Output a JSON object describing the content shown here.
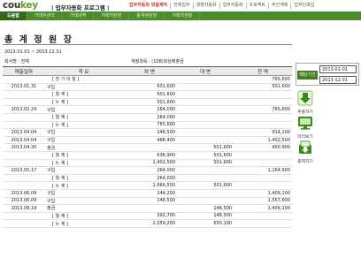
{
  "app": {
    "logo_main": "cou",
    "logo_accent": "key",
    "title": "| 업무자동화 프로그램 |"
  },
  "top_nav": [
    {
      "label": "업무자동화 맞춤제작",
      "active": true
    },
    {
      "label": "전체업무"
    },
    {
      "label": "경영자동화"
    },
    {
      "label": "업무자동화"
    },
    {
      "label": "프로젝트"
    },
    {
      "label": "주간계획"
    },
    {
      "label": "업무단축입"
    }
  ],
  "tabs": [
    {
      "label": "도움말",
      "active": true
    },
    {
      "label": "거래처관리"
    },
    {
      "label": "거래내역"
    },
    {
      "label": "거래처원장"
    },
    {
      "label": "총계정원장"
    },
    {
      "label": "거래처현황"
    }
  ],
  "page": {
    "title": "총 계 정 원 장",
    "date_range": "2013.01.01 ~ 2013.12.31",
    "company_label": "회사명 : 전체",
    "account_label": "계정과목 : (108)외상매출금"
  },
  "table": {
    "headers": [
      "매출일자",
      "적          요",
      "차          변",
      "대          변",
      "잔          액"
    ],
    "rows": [
      [
        "",
        "[ 전  기  이  월 ]",
        "",
        "",
        "765,600"
      ],
      [
        "2013.01.31",
        "구입",
        "501,600",
        "",
        "501,600"
      ],
      [
        "",
        "[    월        계    ]",
        "501,600",
        "",
        ""
      ],
      [
        "",
        "[    누        계    ]",
        "501,600",
        "",
        ""
      ],
      [
        "2013.02.24",
        "구입",
        "264,000",
        "",
        "765,600"
      ],
      [
        "",
        "[    월        계    ]",
        "264,000",
        "",
        ""
      ],
      [
        "",
        "[    누        계    ]",
        "765,600",
        "",
        ""
      ],
      [
        "2013.04.04",
        "구입",
        "148,500",
        "",
        "914,100"
      ],
      [
        "2013.04.04",
        "구입",
        "488,400",
        "",
        "1,402,500"
      ],
      [
        "2013.04.30",
        "출금",
        "",
        "501,600",
        "900,900"
      ],
      [
        "",
        "[    월        계    ]",
        "636,900",
        "501,600",
        ""
      ],
      [
        "",
        "[    누        계    ]",
        "1,402,500",
        "501,600",
        ""
      ],
      [
        "2013.05.17",
        "구입",
        "264,000",
        "",
        "1,164,900"
      ],
      [
        "",
        "[    월        계    ]",
        "264,000",
        "",
        ""
      ],
      [
        "",
        "[    누        계    ]",
        "1,666,500",
        "501,600",
        ""
      ],
      [
        "2013.06.09",
        "구입",
        "244,200",
        "",
        "1,409,100"
      ],
      [
        "2013.06.09",
        "구입",
        "148,500",
        "",
        "1,557,600"
      ],
      [
        "2013.08.19",
        "출금",
        "",
        "148,500",
        "1,409,100"
      ],
      [
        "",
        "[    월        계    ]",
        "392,700",
        "148,500",
        ""
      ],
      [
        "",
        "[    누        계    ]",
        "2,059,200",
        "650,100",
        ""
      ]
    ]
  },
  "side_panel": {
    "period_label": "해당기간",
    "start_date": "2013-01-01",
    "end_date": "2013-12-31",
    "buttons": [
      {
        "label": "추출하기",
        "icon": "download-arrow-icon"
      },
      {
        "label": "미리보기",
        "icon": "monitor-icon"
      },
      {
        "label": "출력하기",
        "icon": "printer-download-icon"
      }
    ]
  },
  "colors": {
    "brand_green": "#4a8c2a",
    "brand_dark_green": "#2f6a16",
    "accent_red": "#c0392b"
  }
}
